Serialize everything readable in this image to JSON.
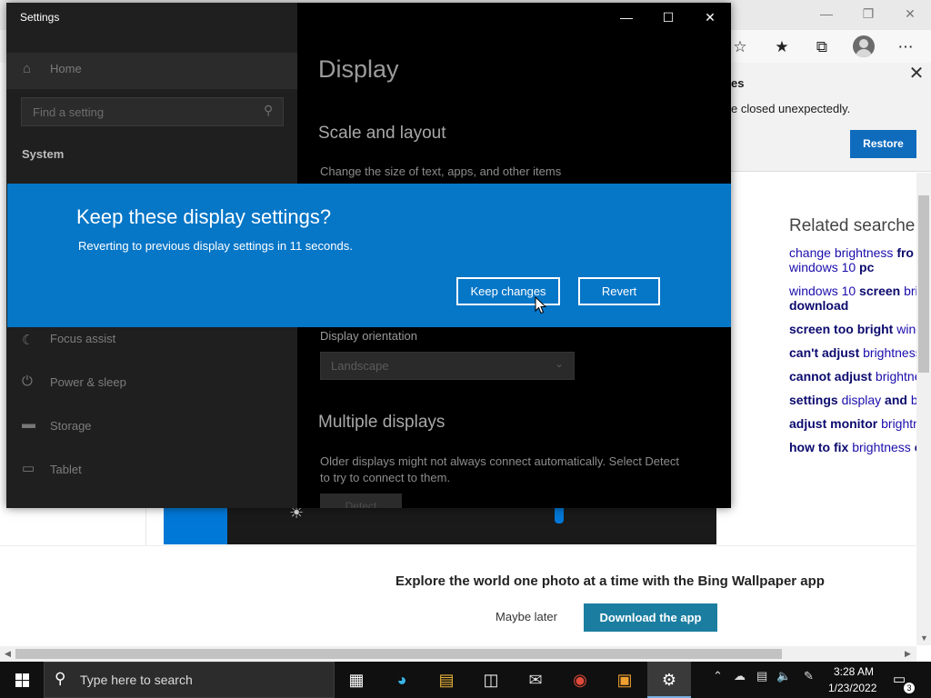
{
  "edge": {
    "restore_title": "es",
    "restore_text": "e closed unexpectedly.",
    "restore_button": "Restore",
    "related_title": "Related searche",
    "related": [
      {
        "bold": "",
        "text": "change brightness ",
        "bold2": "fro"
      },
      {
        "bold": "",
        "text": "windows 10 ",
        "bold2": "pc"
      },
      {
        "bold": "",
        "text": "windows 10 ",
        "bold2": "screen",
        "tail": " bri"
      },
      {
        "bold": "download",
        "text": "",
        "bold2": ""
      },
      {
        "bold": "screen too bright",
        "text": " wind",
        "bold2": ""
      },
      {
        "bold": "can't adjust",
        "text": " brightness",
        "bold2": ""
      },
      {
        "bold": "cannot adjust",
        "text": " brightne",
        "bold2": ""
      },
      {
        "bold": "settings",
        "text": " display ",
        "bold2": "and",
        "tail": " br"
      },
      {
        "bold": "adjust monitor",
        "text": " brightn",
        "bold2": ""
      },
      {
        "bold": "how to fix",
        "text": " brightness ",
        "bold2": "c"
      }
    ],
    "promo_text": "Explore the world one photo at a time with the Bing Wallpaper app",
    "maybe_later": "Maybe later",
    "download_app": "Download the app"
  },
  "settings": {
    "window_title": "Settings",
    "home": "Home",
    "search_placeholder": "Find a setting",
    "system": "System",
    "nav": [
      {
        "label": "Focus assist",
        "icon": "moon-icon"
      },
      {
        "label": "Power & sleep",
        "icon": "power-icon"
      },
      {
        "label": "Storage",
        "icon": "storage-icon"
      },
      {
        "label": "Tablet",
        "icon": "tablet-icon"
      }
    ],
    "page_title": "Display",
    "scale_heading": "Scale and layout",
    "scale_text": "Change the size of text, apps, and other items",
    "orientation_label": "Display orientation",
    "orientation_value": "Landscape",
    "multiple_heading": "Multiple displays",
    "multiple_text_1": "Older displays might not always connect automatically. Select Detect",
    "multiple_text_2": "to try to connect to them.",
    "detect": "Detect"
  },
  "dialog": {
    "title": "Keep these display settings?",
    "message": "Reverting to previous display settings in 11 seconds.",
    "keep": "Keep changes",
    "revert": "Revert"
  },
  "taskbar": {
    "search_placeholder": "Type here to search",
    "time": "3:28 AM",
    "date": "1/23/2022",
    "notification_count": "3"
  }
}
